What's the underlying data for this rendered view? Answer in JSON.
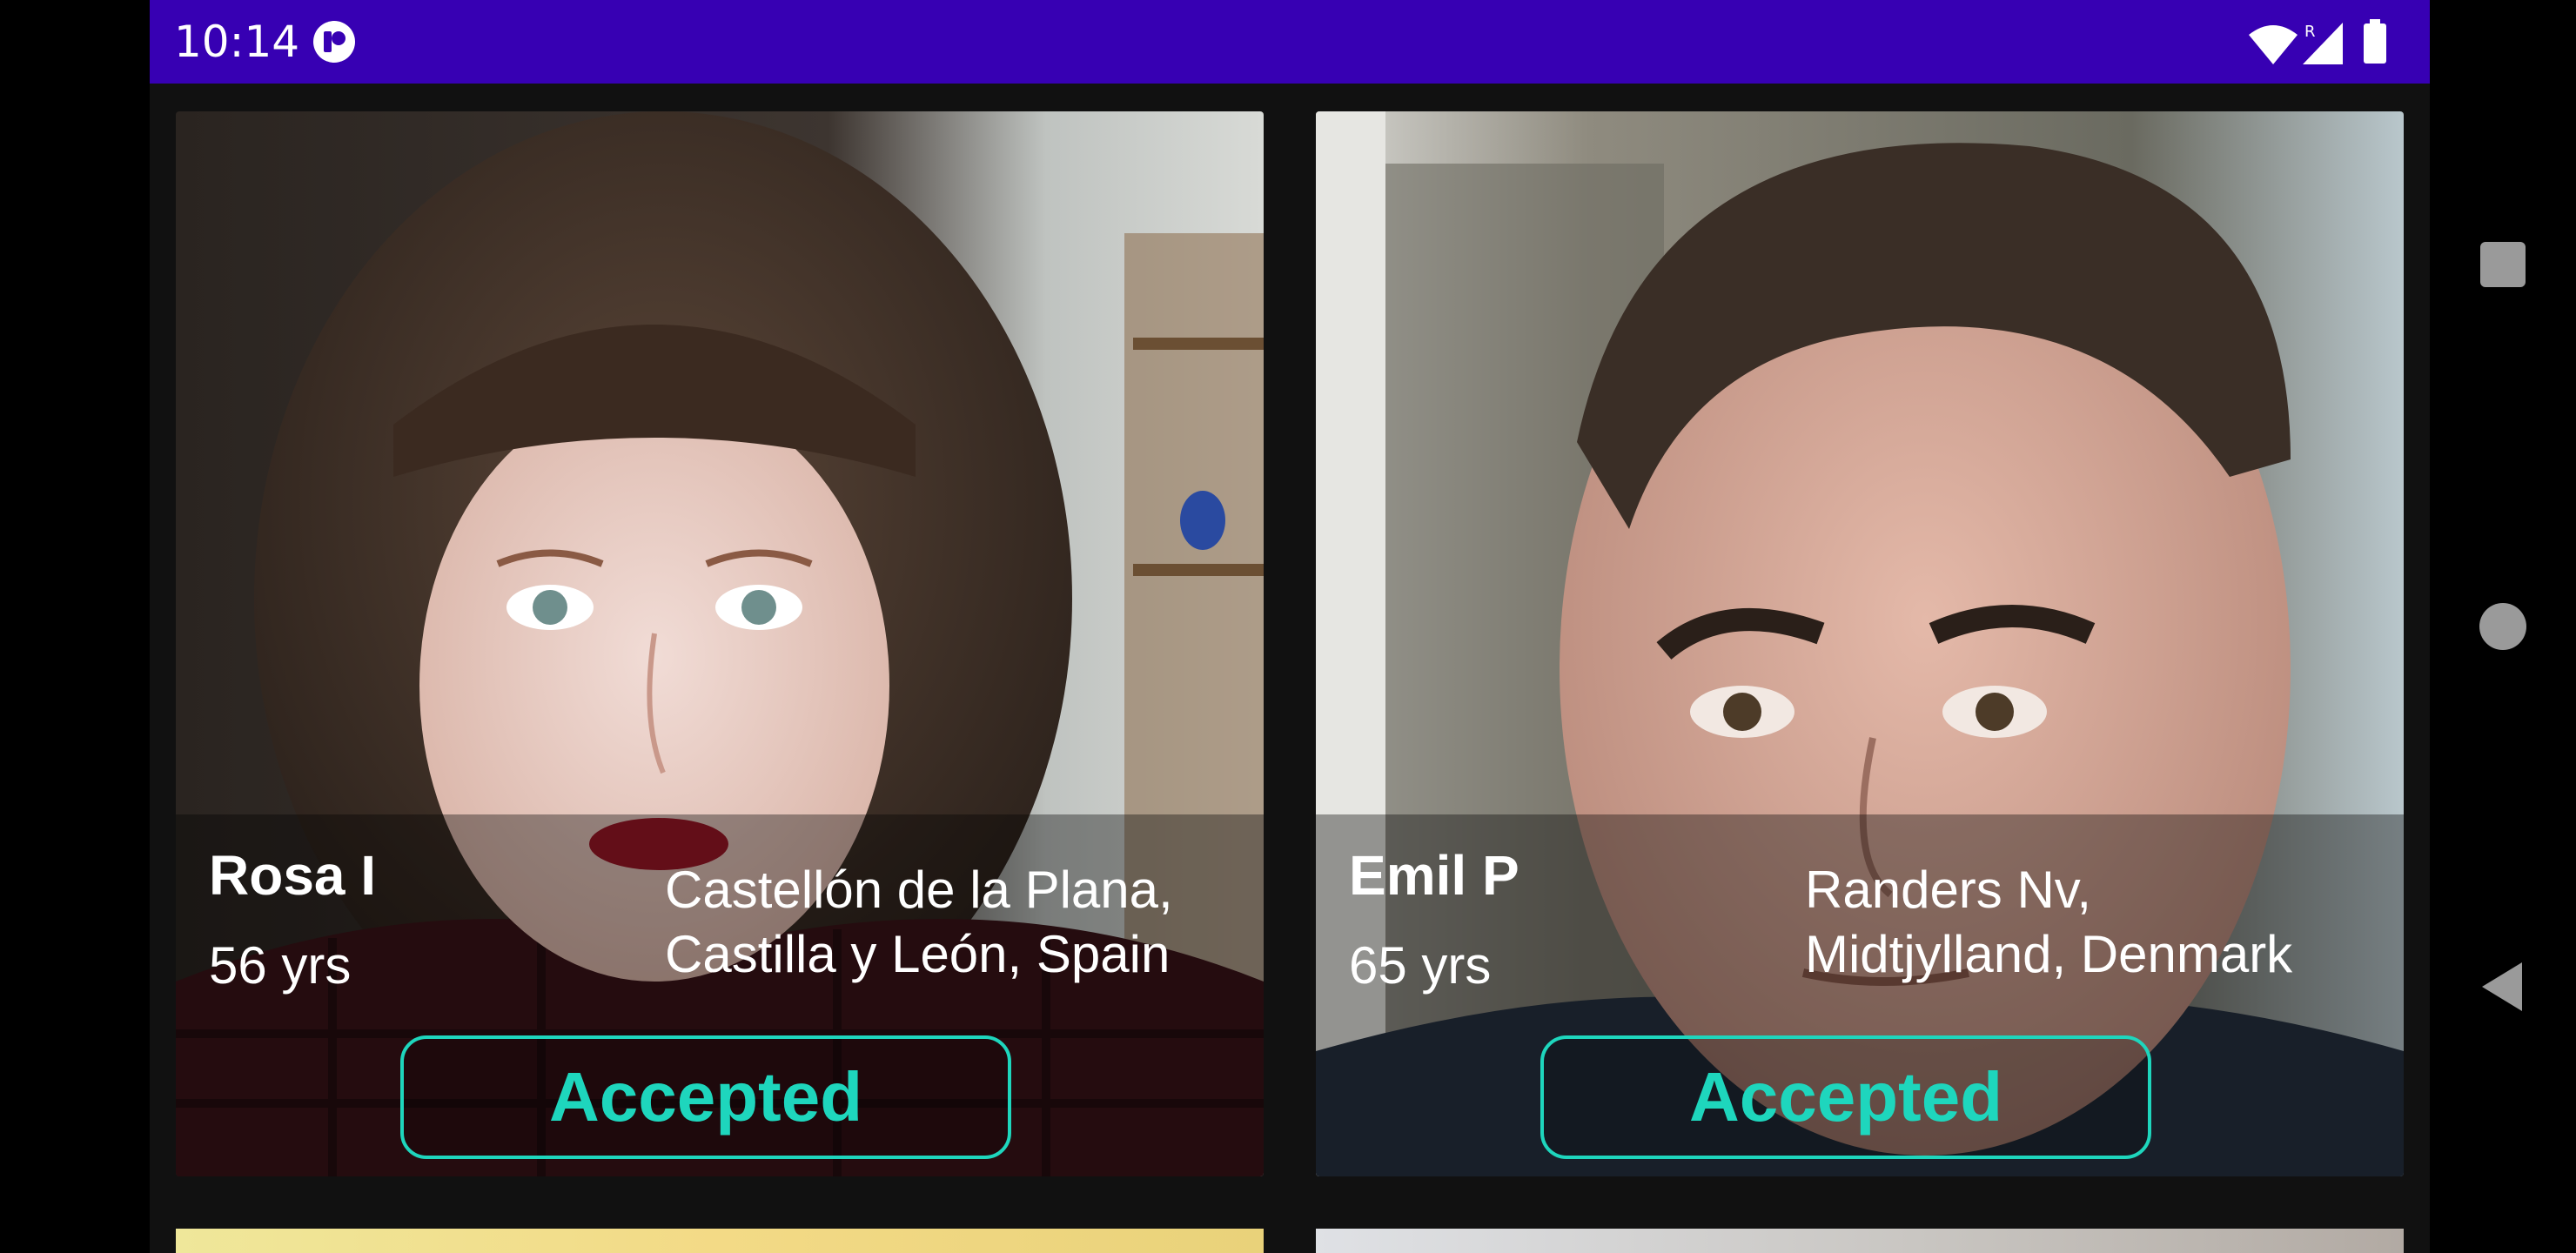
{
  "status_bar": {
    "time": "10:14",
    "roaming_indicator": "R",
    "icons": [
      "app-notification-icon",
      "wifi-icon",
      "signal-icon",
      "battery-icon"
    ]
  },
  "profiles": [
    {
      "name": "Rosa I",
      "age": "56 yrs",
      "location_line1": "Castellón de la Plana,",
      "location_line2": "Castilla y León, Spain",
      "status": "Accepted"
    },
    {
      "name": "Emil P",
      "age": "65 yrs",
      "location_line1": "Randers Nv,",
      "location_line2": "Midtjylland, Denmark",
      "status": "Accepted"
    }
  ],
  "nav_bar": {
    "icons": [
      "recents-icon",
      "home-icon",
      "back-icon"
    ]
  },
  "colors": {
    "status_bar": "#3700b3",
    "accent": "#1ed6bd",
    "background": "#111111"
  }
}
